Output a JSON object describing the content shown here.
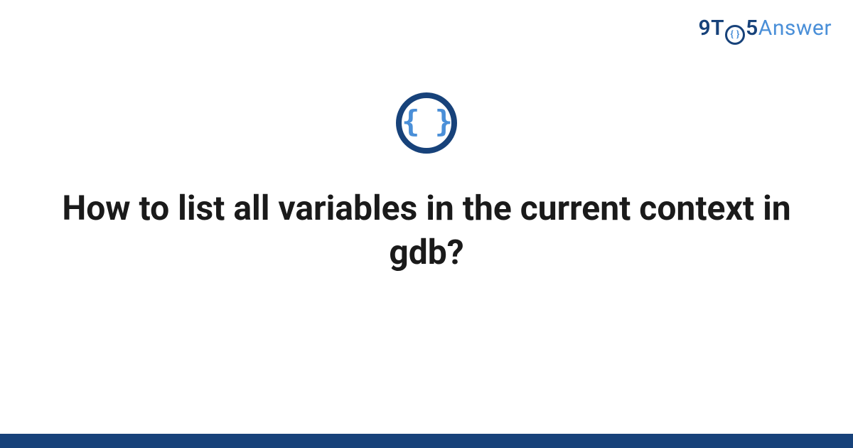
{
  "logo": {
    "prefix_9t": "9T",
    "circle_inner": "{ }",
    "five": "5",
    "answer": "Answer"
  },
  "icon": {
    "glyph": "{ }",
    "semantic": "code-braces-icon"
  },
  "main": {
    "title": "How to list all variables in the current context in gdb?"
  },
  "colors": {
    "brand_dark": "#17427a",
    "brand_light": "#4a8fd8"
  }
}
